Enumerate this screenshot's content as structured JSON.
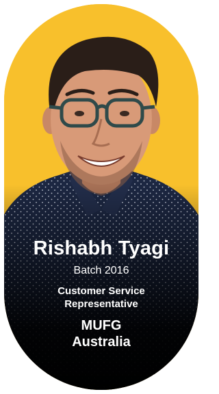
{
  "profile": {
    "name": "Rishabh Tyagi",
    "batch": "Batch 2016",
    "role_line1": "Customer Service",
    "role_line2": "Representative",
    "company_line1": "MUFG",
    "company_line2": "Australia"
  },
  "colors": {
    "background": "#f8c02c",
    "text": "#ffffff",
    "shirt": "#1f2a44",
    "fade": "#000000"
  }
}
